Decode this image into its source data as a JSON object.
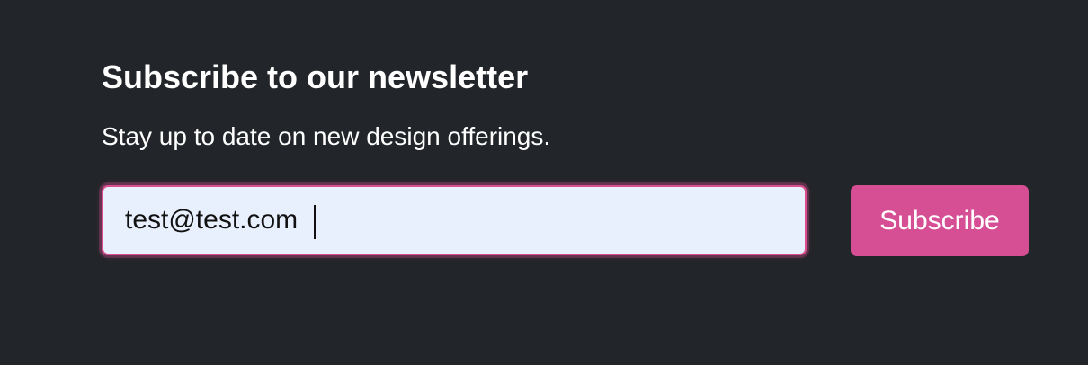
{
  "newsletter": {
    "heading": "Subscribe to our newsletter",
    "description": "Stay up to date on new design offerings.",
    "email": {
      "value": "test@test.com",
      "focused": true
    },
    "subscribe_label": "Subscribe"
  },
  "colors": {
    "background": "#222529",
    "accent": "#d64e94",
    "input_background": "#e8effd",
    "text": "#ffffff"
  }
}
